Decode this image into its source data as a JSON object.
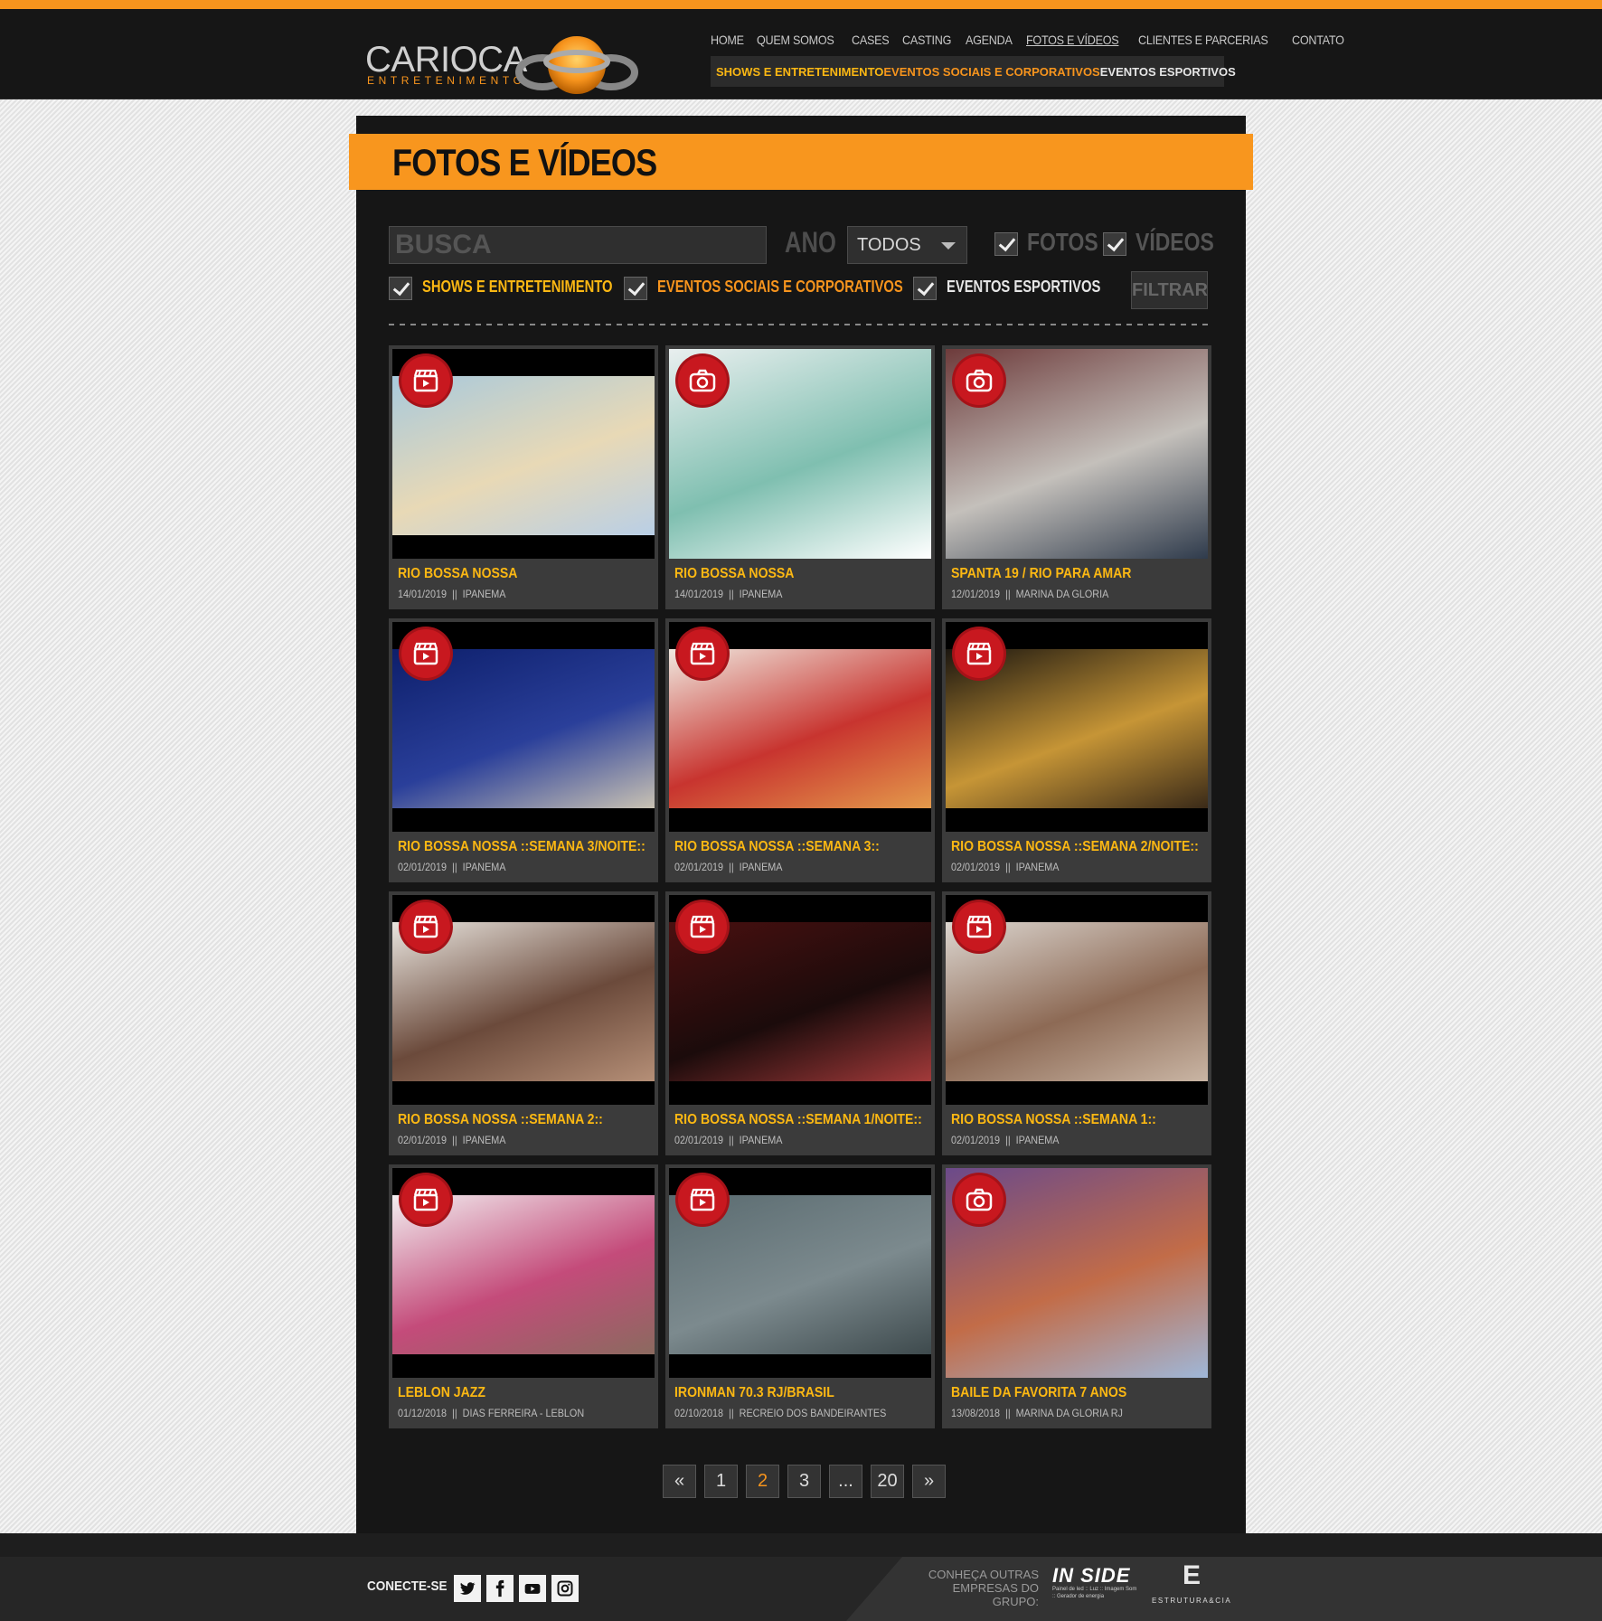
{
  "header": {
    "brand": "CARIOCA",
    "brand_sub": "ENTRETENIMENTO",
    "nav": [
      "HOME",
      "QUEM SOMOS",
      "CASES",
      "CASTING",
      "AGENDA",
      "FOTOS E VÍDEOS",
      "CLIENTES E PARCERIAS",
      "CONTATO"
    ],
    "subnav": [
      "SHOWS E ENTRETENIMENTO",
      "EVENTOS SOCIAIS E CORPORATIVOS",
      "EVENTOS ESPORTIVOS"
    ]
  },
  "page": {
    "title": "FOTOS E VÍDEOS"
  },
  "filters": {
    "search_placeholder": "BUSCA",
    "ano_label": "ANO",
    "ano_value": "TODOS",
    "fotos_label": "FOTOS",
    "videos_label": "VÍDEOS",
    "categories": [
      "SHOWS E ENTRETENIMENTO",
      "EVENTOS SOCIAIS E CORPORATIVOS",
      "EVENTOS ESPORTIVOS"
    ],
    "filtrar_label": "FILTRAR"
  },
  "items": [
    {
      "title": "RIO BOSSA NOSSA",
      "date": "14/01/2019",
      "place": "IPANEMA",
      "type": "video-icon"
    },
    {
      "title": "RIO BOSSA NOSSA",
      "date": "14/01/2019",
      "place": "IPANEMA",
      "type": "camera-icon"
    },
    {
      "title": "SPANTA 19 / RIO PARA AMAR",
      "date": "12/01/2019",
      "place": "MARINA DA GLORIA",
      "type": "camera-icon"
    },
    {
      "title": "RIO BOSSA NOSSA ::SEMANA 3/NOITE::",
      "date": "02/01/2019",
      "place": "IPANEMA",
      "type": "video-icon"
    },
    {
      "title": "RIO BOSSA NOSSA ::SEMANA 3::",
      "date": "02/01/2019",
      "place": "IPANEMA",
      "type": "video-icon"
    },
    {
      "title": "RIO BOSSA NOSSA ::SEMANA 2/NOITE::",
      "date": "02/01/2019",
      "place": "IPANEMA",
      "type": "video-icon"
    },
    {
      "title": "RIO BOSSA NOSSA ::SEMANA 2::",
      "date": "02/01/2019",
      "place": "IPANEMA",
      "type": "video-icon"
    },
    {
      "title": "RIO BOSSA NOSSA ::SEMANA 1/NOITE::",
      "date": "02/01/2019",
      "place": "IPANEMA",
      "type": "video-icon"
    },
    {
      "title": "RIO BOSSA NOSSA ::SEMANA 1::",
      "date": "02/01/2019",
      "place": "IPANEMA",
      "type": "video-icon"
    },
    {
      "title": "LEBLON JAZZ",
      "date": "01/12/2018",
      "place": "DIAS FERREIRA - LEBLON",
      "type": "video-icon"
    },
    {
      "title": "IRONMAN 70.3 RJ/BRASIL",
      "date": "02/10/2018",
      "place": "RECREIO DOS BANDEIRANTES",
      "type": "video-icon"
    },
    {
      "title": "BAILE DA FAVORITA 7 ANOS",
      "date": "13/08/2018",
      "place": "MARINA DA GLORIA RJ",
      "type": "camera-icon"
    }
  ],
  "meta_separator": "||",
  "pagination": {
    "prev": "«",
    "pages": [
      "1",
      "2",
      "3",
      "...",
      "20"
    ],
    "current": "2",
    "next": "»"
  },
  "footer": {
    "conecte": "CONECTE-SE",
    "social": [
      "twitter-icon",
      "facebook-icon",
      "youtube-icon",
      "instagram-icon"
    ],
    "conheca_line1": "CONHEÇA OUTRAS",
    "conheca_line2": "EMPRESAS DO GRUPO:",
    "inside_name": "IN SIDE",
    "inside_tag": "Painel de led :: Luz :: Imagem Som :: Gerador de energia",
    "estrutura_name": "ESTRUTURA&CIA"
  },
  "colors": {
    "accent": "#f7941d",
    "yellow": "#fcb813",
    "badge": "#c8181f"
  }
}
